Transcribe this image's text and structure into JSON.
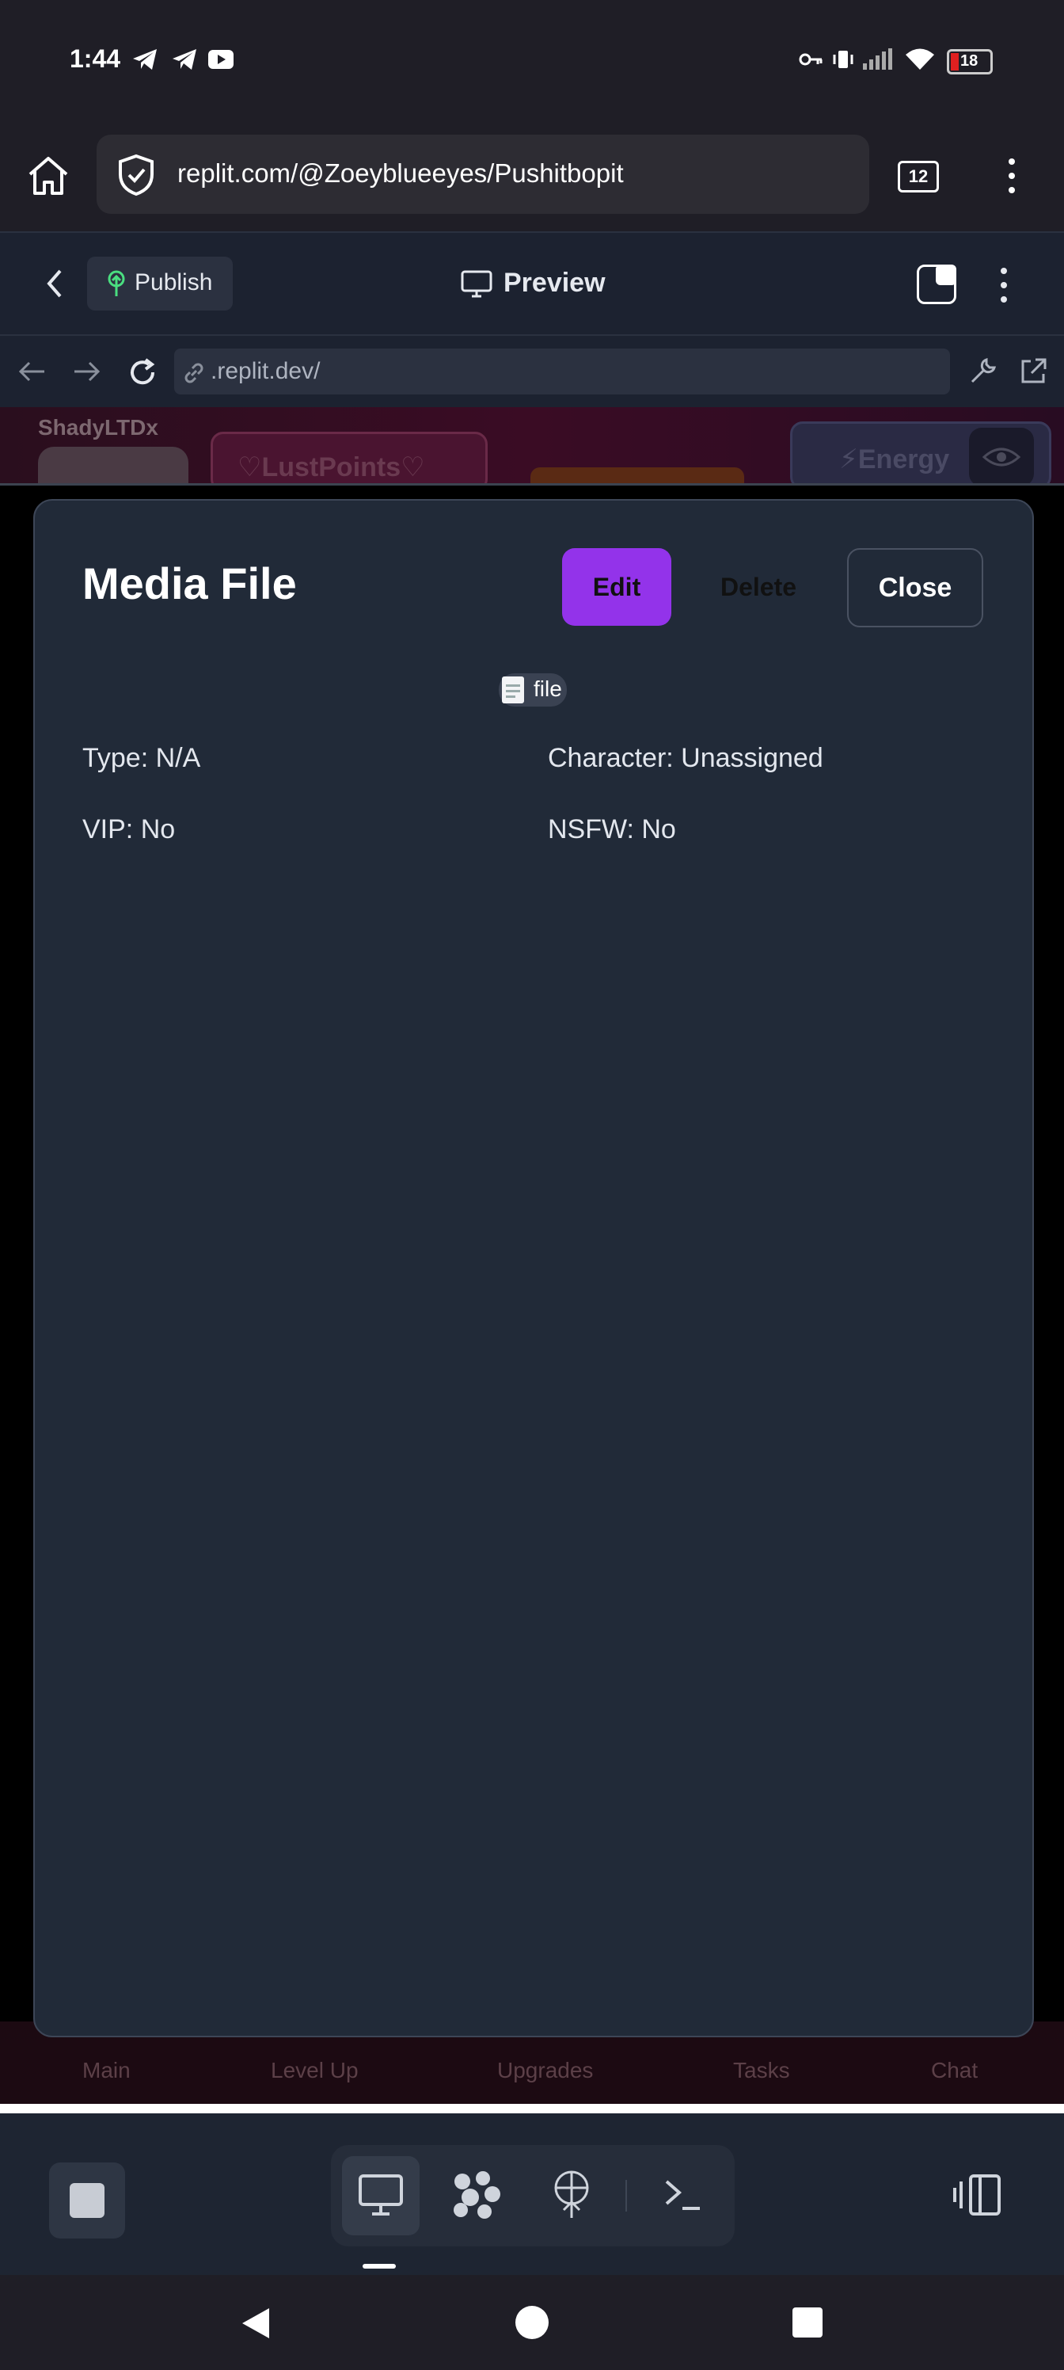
{
  "status_bar": {
    "time": "1:44",
    "notification_icons": [
      "telegram-icon",
      "telegram-icon",
      "youtube-icon"
    ],
    "system_icons": [
      "key-icon",
      "vibrate-icon",
      "signal-icon",
      "wifi-icon",
      "battery-icon"
    ],
    "battery_level": "18"
  },
  "browser": {
    "url": "replit.com/@Zoeyblueeyes/Pushitbopit",
    "tab_count": "12"
  },
  "replit_header": {
    "publish_label": "Publish",
    "preview_label": "Preview"
  },
  "nav_bar": {
    "url": ".replit.dev/"
  },
  "background_app": {
    "username": "ShadyLTDx",
    "lust_points_label": "LustPoints",
    "energy_label": "Energy",
    "tabs": [
      "Main",
      "Level Up",
      "Upgrades",
      "Tasks",
      "Chat"
    ]
  },
  "modal": {
    "title": "Media File",
    "edit_label": "Edit",
    "delete_label": "Delete",
    "close_label": "Close",
    "file_chip": "file",
    "type": "Type: N/A",
    "character": "Character: Unassigned",
    "vip": "VIP: No",
    "nsfw": "NSFW: No"
  },
  "colors": {
    "modal_bg": "#212a38",
    "edit_button": "#9333ea",
    "page_bg": "#000000"
  }
}
